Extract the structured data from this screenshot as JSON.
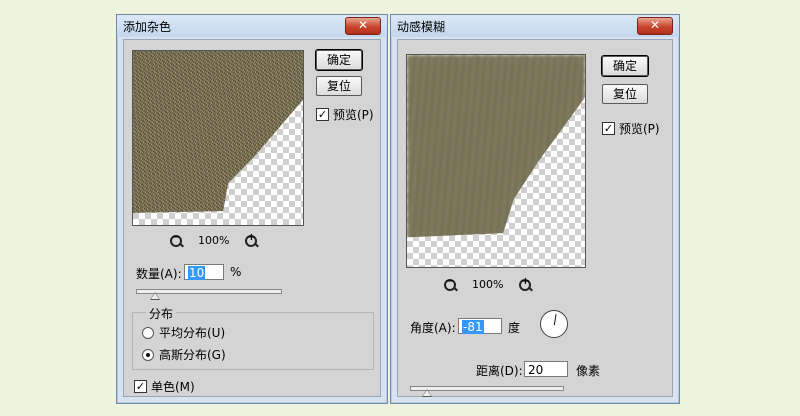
{
  "left_dialog": {
    "title": "添加杂色",
    "close": "✕",
    "ok": "确定",
    "reset": "复位",
    "preview_label": "预览(P)",
    "preview_checked": true,
    "zoom_level": "100%",
    "amount_label": "数量(A):",
    "amount_value": "10",
    "amount_unit": "%",
    "amount_slider_value": 10,
    "distribution_label": "分布",
    "uniform_label": "平均分布(U)",
    "gaussian_label": "高斯分布(G)",
    "distribution_selected": "gaussian",
    "monochrome_label": "单色(M)",
    "monochrome_checked": true
  },
  "right_dialog": {
    "title": "动感模糊",
    "close": "✕",
    "ok": "确定",
    "reset": "复位",
    "preview_label": "预览(P)",
    "preview_checked": true,
    "zoom_level": "100%",
    "angle_label": "角度(A):",
    "angle_value": "-81",
    "angle_unit": "度",
    "distance_label": "距离(D):",
    "distance_value": "20",
    "distance_unit": "像素",
    "distance_slider_value": 20
  },
  "icons": {
    "zoom_out": "zoom-out-icon",
    "zoom_in": "zoom-in-icon",
    "check": "✓"
  },
  "colors": {
    "background": "#eef3dd",
    "title_bar": "#c4d7ee",
    "close_button": "#c8452c",
    "texture": "#776c4c"
  }
}
